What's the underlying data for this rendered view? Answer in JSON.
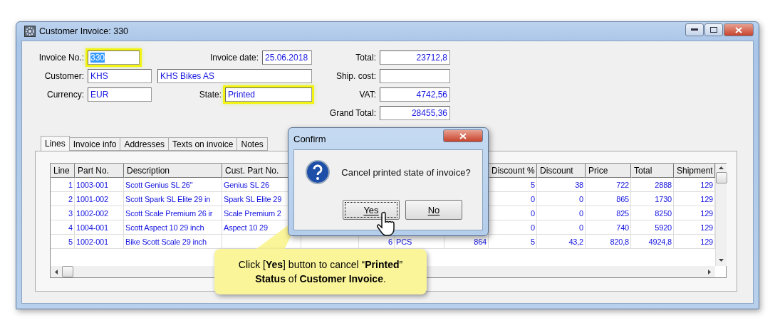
{
  "window": {
    "title": "Customer Invoice: 330"
  },
  "form": {
    "invoice_no": {
      "label": "Invoice No.:",
      "value": "330",
      "highlighted": true,
      "selected": true
    },
    "invoice_date": {
      "label": "Invoice date:",
      "value": "25.06.2018"
    },
    "customer": {
      "label": "Customer:",
      "value": "KHS",
      "name": "KHS Bikes AS"
    },
    "currency": {
      "label": "Currency:",
      "value": "EUR"
    },
    "state": {
      "label": "State:",
      "value": "Printed",
      "highlighted": true,
      "selected": false
    },
    "total": {
      "label": "Total:",
      "value": "23712,8"
    },
    "ship_cost": {
      "label": "Ship. cost:"
    },
    "vat": {
      "label": "VAT:",
      "value": "4742,56"
    },
    "grand_total": {
      "label": "Grand Total:",
      "value": "28455,36"
    }
  },
  "tabs": [
    {
      "label": "Lines",
      "selected": true
    },
    {
      "label": "Invoice info",
      "selected": false
    },
    {
      "label": "Addresses",
      "selected": false
    },
    {
      "label": "Texts on invoice",
      "selected": false
    },
    {
      "label": "Notes",
      "selected": false
    }
  ],
  "table": {
    "columns": [
      "Line",
      "Part No.",
      "Description",
      "Cust. Part No.",
      "",
      "",
      "",
      "",
      "Discount %",
      "Discount",
      "Price",
      "Total",
      "Shipment"
    ],
    "rows": [
      {
        "cells": [
          "1",
          "1003-001",
          "Scott Genius SL 26\"",
          "Genius SL 26",
          "",
          "",
          "",
          "",
          "5",
          "38",
          "722",
          "2888",
          "129"
        ]
      },
      {
        "cells": [
          "2",
          "1001-002",
          "Scott Spark SL Elite 29 in",
          "Spark SL Elite 29",
          "",
          "",
          "",
          "",
          "0",
          "0",
          "865",
          "1730",
          "129"
        ]
      },
      {
        "cells": [
          "3",
          "1002-002",
          "Scott Scale Premium 26 ir",
          "Scale Premium 2",
          "",
          "",
          "",
          "",
          "0",
          "0",
          "825",
          "8250",
          "129"
        ]
      },
      {
        "cells": [
          "4",
          "1004-001",
          "Scott Aspect 10 29 inch",
          "Aspect 10 29",
          "",
          "",
          "",
          "",
          "0",
          "0",
          "740",
          "5920",
          "129"
        ]
      },
      {
        "cells": [
          "5",
          "1002-001",
          "Bike Scott Scale 29 inch",
          "",
          "",
          "6",
          "PCS",
          "864",
          "5",
          "43,2",
          "820,8",
          "4924,8",
          "129"
        ]
      }
    ]
  },
  "dialog": {
    "title": "Confirm",
    "message": "Cancel printed state of invoice?",
    "buttons": [
      {
        "label": "Yes",
        "focused": true
      },
      {
        "label": "No",
        "focused": false
      }
    ]
  },
  "callout": {
    "text": "Click [**Yes**] button to cancel “**Printed**” **Status** of **Customer Invoice**."
  }
}
